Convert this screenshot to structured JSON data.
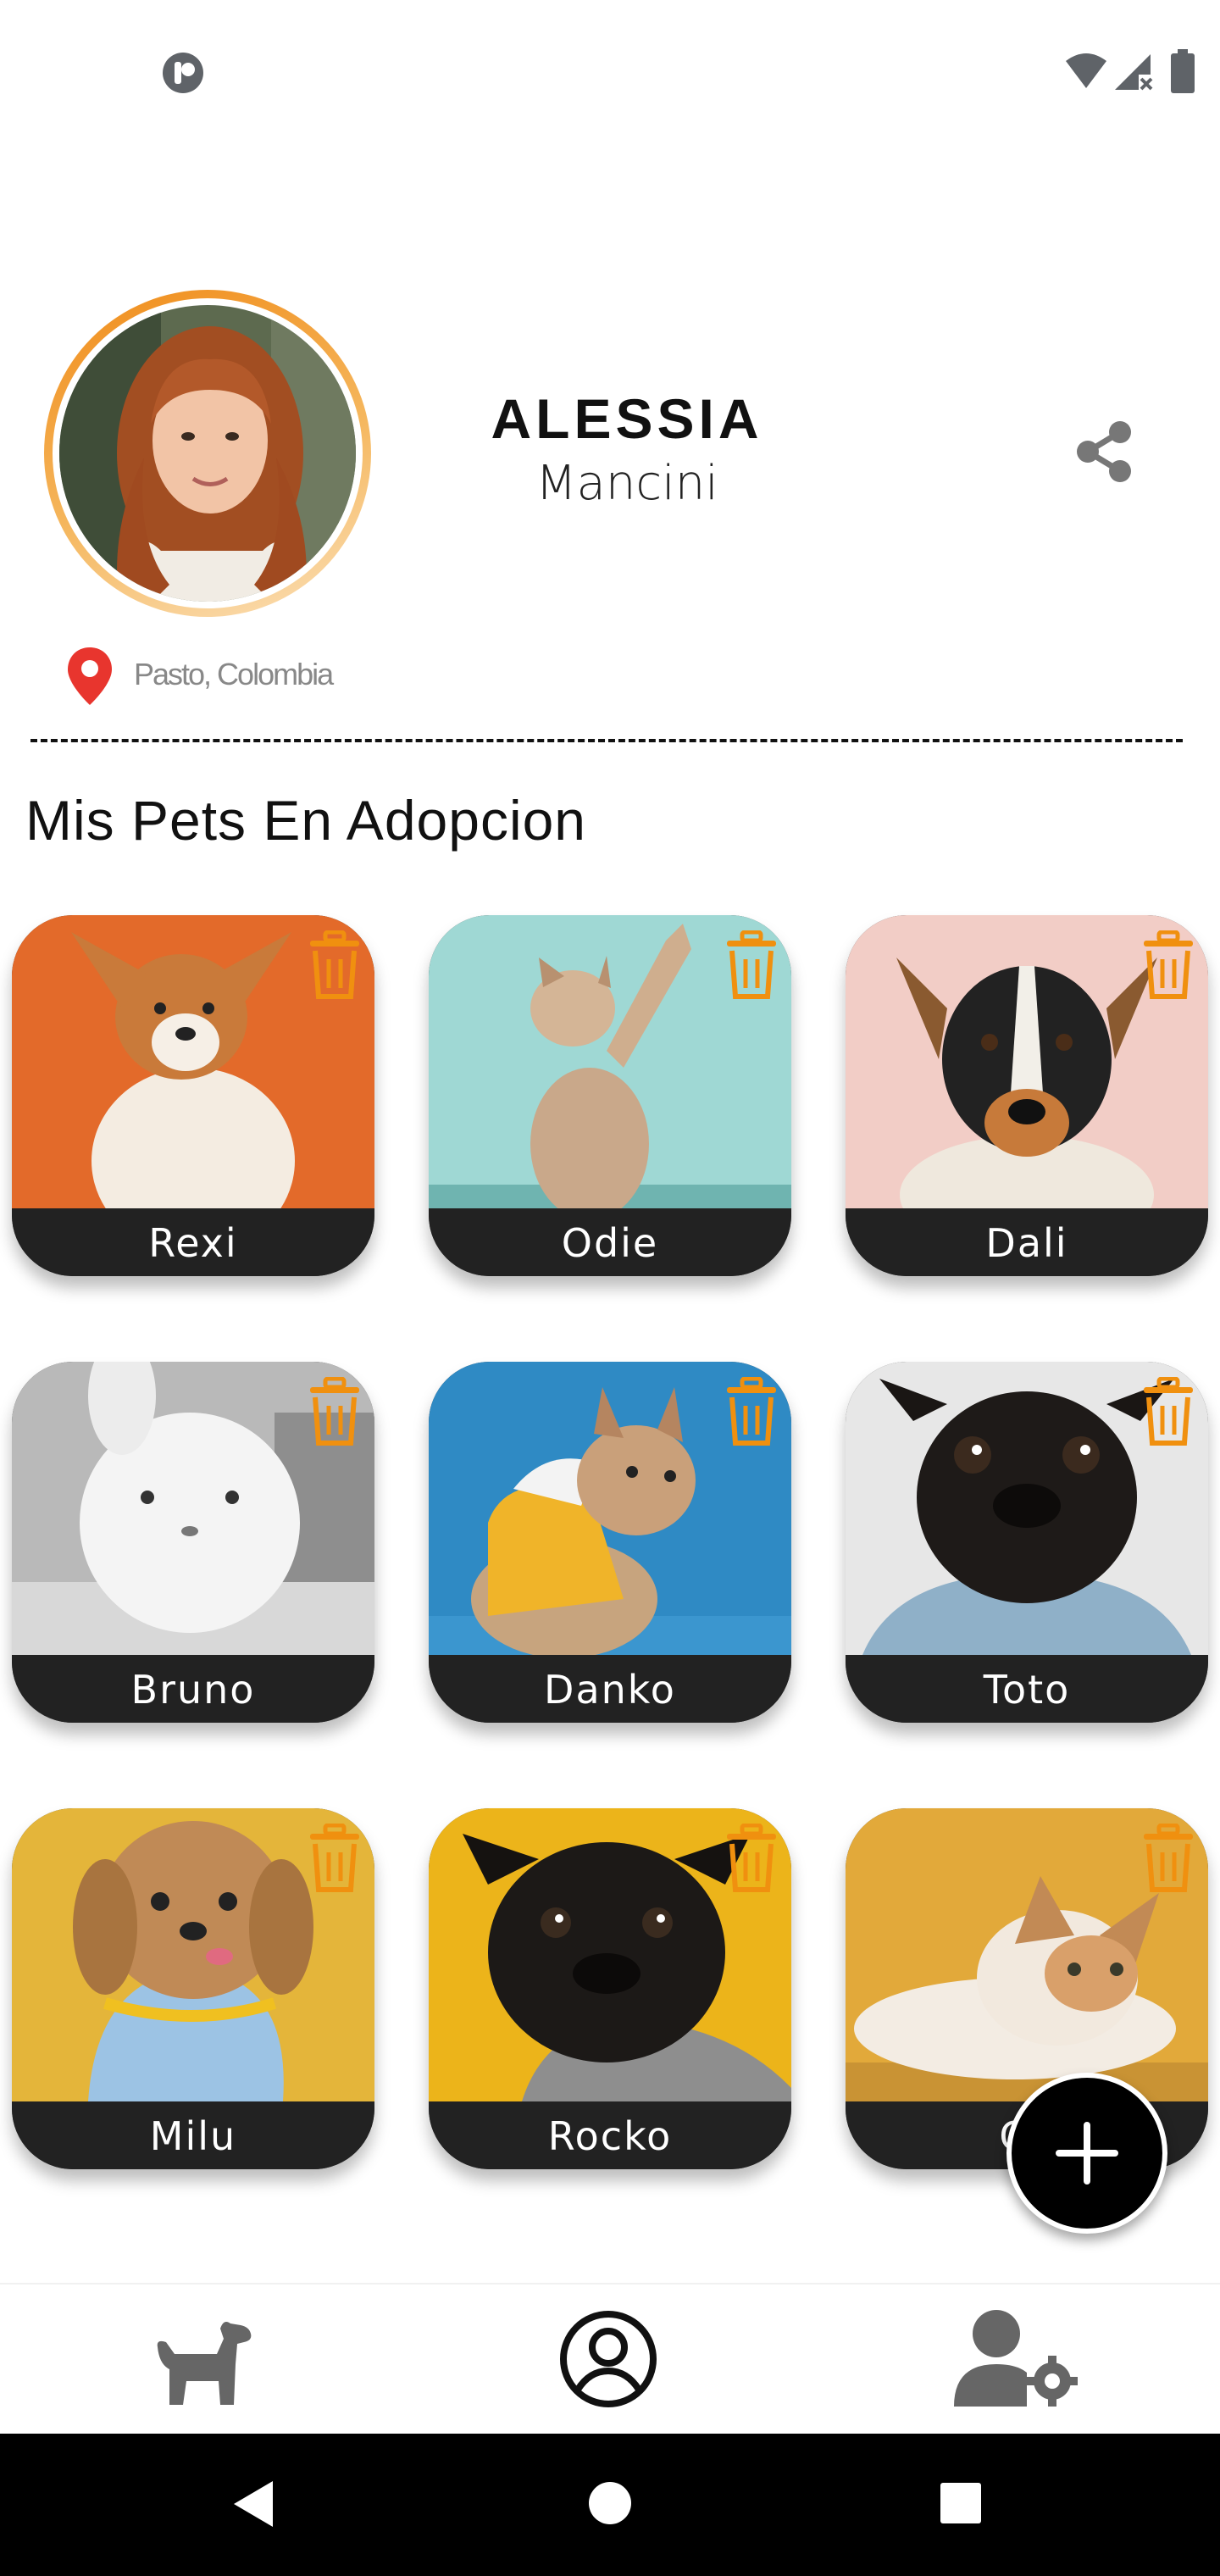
{
  "profile": {
    "first_name": "ALESSIA",
    "last_name": "Mancini",
    "location": "Pasto, Colombia"
  },
  "section": {
    "title": "Mis Pets En Adopcion"
  },
  "pets": [
    {
      "name": "Rexi"
    },
    {
      "name": "Odie"
    },
    {
      "name": "Dali"
    },
    {
      "name": "Bruno"
    },
    {
      "name": "Danko"
    },
    {
      "name": "Toto"
    },
    {
      "name": "Milu"
    },
    {
      "name": "Rocko"
    },
    {
      "name": "Ch"
    }
  ],
  "colors": {
    "accent_orange": "#f0900f",
    "location_red": "#e8352e",
    "card_label_bg": "#222222",
    "icon_grey": "#777777"
  },
  "icons": {
    "share": "share-icon",
    "location": "location-pin-icon",
    "delete": "trash-icon",
    "add": "plus-icon",
    "nav_pets": "dog-icon",
    "nav_profile": "user-circle-icon",
    "nav_settings": "user-gear-icon"
  }
}
